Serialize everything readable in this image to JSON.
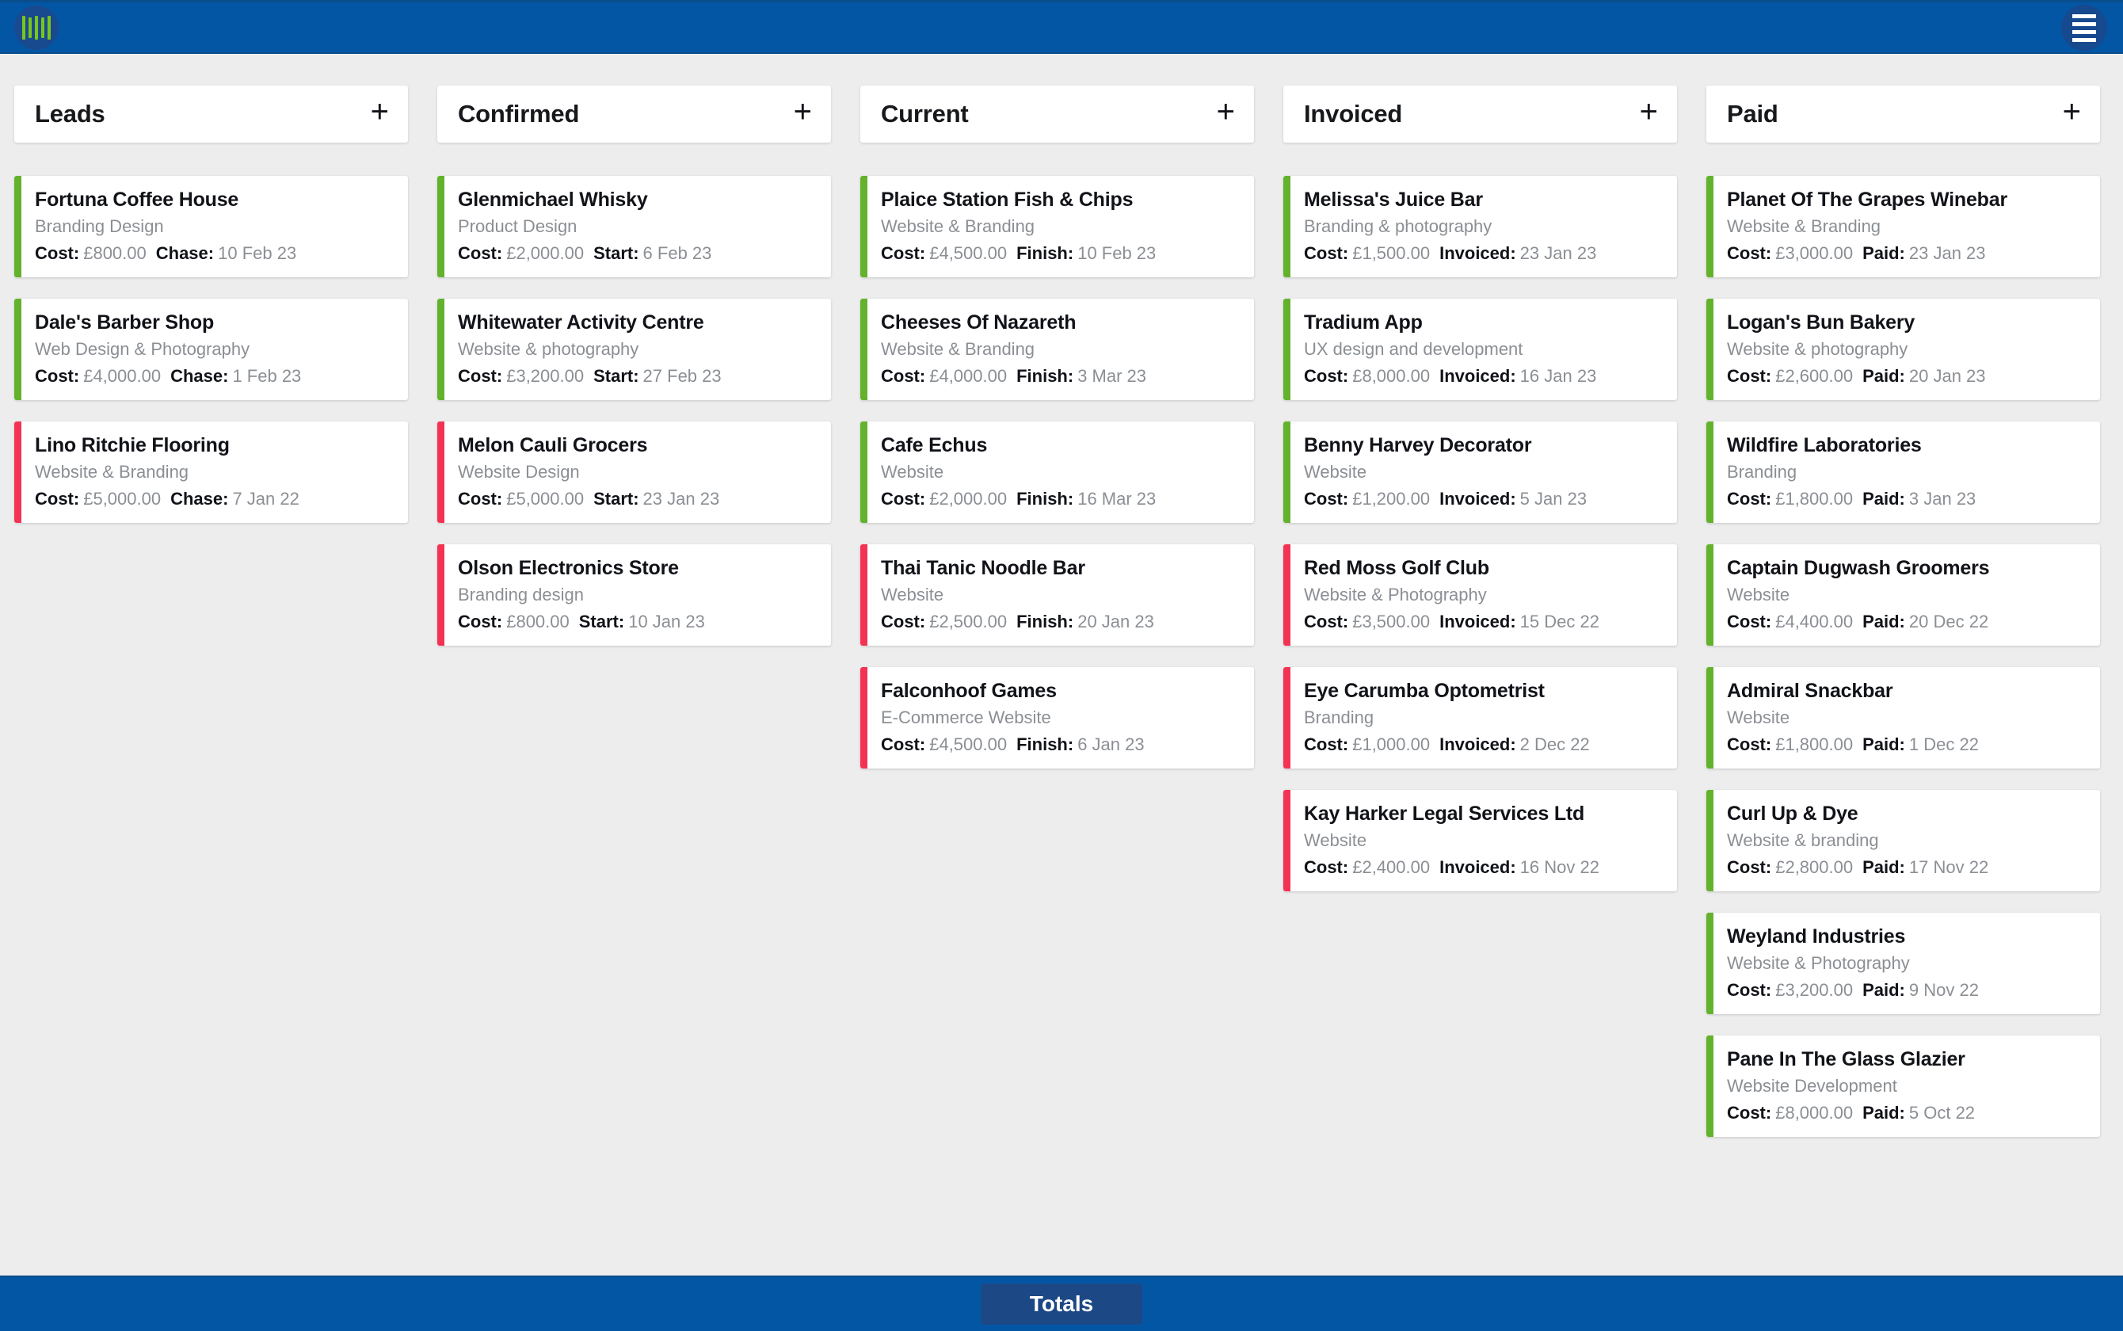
{
  "appbar": {
    "logo_icon": "barcode-logo-icon",
    "menu_icon": "hamburger-menu-icon"
  },
  "colors": {
    "header_blue": "#0356a4",
    "footer_blue": "#0356a4",
    "totals_button": "#1c4886",
    "accent_green": "#63b22d",
    "accent_red": "#f43254",
    "board_background": "#ededed",
    "card_background": "#ffffff"
  },
  "board": {
    "add_label": "+",
    "columns": [
      {
        "title": "Leads",
        "date_label": "Chase:",
        "cost_label": "Cost:",
        "cards": [
          {
            "name": "Fortuna Coffee House",
            "service": "Branding Design",
            "cost": "£800.00",
            "date": "10 Feb 23",
            "accent": "green"
          },
          {
            "name": "Dale's Barber Shop",
            "service": "Web Design & Photography",
            "cost": "£4,000.00",
            "date": "1 Feb 23",
            "accent": "green"
          },
          {
            "name": "Lino Ritchie Flooring",
            "service": "Website & Branding",
            "cost": "£5,000.00",
            "date": "7 Jan 22",
            "accent": "red"
          }
        ]
      },
      {
        "title": "Confirmed",
        "date_label": "Start:",
        "cost_label": "Cost:",
        "cards": [
          {
            "name": "Glenmichael Whisky",
            "service": "Product Design",
            "cost": "£2,000.00",
            "date": "6 Feb 23",
            "accent": "green"
          },
          {
            "name": "Whitewater Activity Centre",
            "service": "Website & photography",
            "cost": "£3,200.00",
            "date": "27 Feb 23",
            "accent": "green"
          },
          {
            "name": "Melon Cauli Grocers",
            "service": "Website Design",
            "cost": "£5,000.00",
            "date": "23 Jan 23",
            "accent": "red"
          },
          {
            "name": "Olson Electronics Store",
            "service": "Branding design",
            "cost": "£800.00",
            "date": "10 Jan 23",
            "accent": "red"
          }
        ]
      },
      {
        "title": "Current",
        "date_label": "Finish:",
        "cost_label": "Cost:",
        "cards": [
          {
            "name": "Plaice Station Fish & Chips",
            "service": "Website & Branding",
            "cost": "£4,500.00",
            "date": "10 Feb 23",
            "accent": "green"
          },
          {
            "name": "Cheeses Of Nazareth",
            "service": "Website & Branding",
            "cost": "£4,000.00",
            "date": "3 Mar 23",
            "accent": "green"
          },
          {
            "name": "Cafe Echus",
            "service": "Website",
            "cost": "£2,000.00",
            "date": "16 Mar 23",
            "accent": "green"
          },
          {
            "name": "Thai Tanic Noodle Bar",
            "service": "Website",
            "cost": "£2,500.00",
            "date": "20 Jan 23",
            "accent": "red"
          },
          {
            "name": "Falconhoof Games",
            "service": "E-Commerce Website",
            "cost": "£4,500.00",
            "date": "6 Jan 23",
            "accent": "red"
          }
        ]
      },
      {
        "title": "Invoiced",
        "date_label": "Invoiced:",
        "cost_label": "Cost:",
        "cards": [
          {
            "name": "Melissa's Juice Bar",
            "service": "Branding & photography",
            "cost": "£1,500.00",
            "date": "23 Jan 23",
            "accent": "green"
          },
          {
            "name": "Tradium App",
            "service": "UX design and development",
            "cost": "£8,000.00",
            "date": "16 Jan 23",
            "accent": "green"
          },
          {
            "name": "Benny Harvey Decorator",
            "service": "Website",
            "cost": "£1,200.00",
            "date": "5 Jan 23",
            "accent": "green"
          },
          {
            "name": "Red Moss Golf Club",
            "service": "Website & Photography",
            "cost": "£3,500.00",
            "date": "15 Dec 22",
            "accent": "red"
          },
          {
            "name": "Eye Carumba Optometrist",
            "service": "Branding",
            "cost": "£1,000.00",
            "date": "2 Dec 22",
            "accent": "red"
          },
          {
            "name": "Kay Harker Legal Services Ltd",
            "service": "Website",
            "cost": "£2,400.00",
            "date": "16 Nov 22",
            "accent": "red"
          }
        ]
      },
      {
        "title": "Paid",
        "date_label": "Paid:",
        "cost_label": "Cost:",
        "cards": [
          {
            "name": "Planet Of The Grapes Winebar",
            "service": "Website & Branding",
            "cost": "£3,000.00",
            "date": "23 Jan 23",
            "accent": "green"
          },
          {
            "name": "Logan's Bun Bakery",
            "service": "Website & photography",
            "cost": "£2,600.00",
            "date": "20 Jan 23",
            "accent": "green"
          },
          {
            "name": "Wildfire Laboratories",
            "service": "Branding",
            "cost": "£1,800.00",
            "date": "3 Jan 23",
            "accent": "green"
          },
          {
            "name": "Captain Dugwash Groomers",
            "service": "Website",
            "cost": "£4,400.00",
            "date": "20 Dec 22",
            "accent": "green"
          },
          {
            "name": "Admiral Snackbar",
            "service": "Website",
            "cost": "£1,800.00",
            "date": "1 Dec 22",
            "accent": "green"
          },
          {
            "name": "Curl Up & Dye",
            "service": "Website & branding",
            "cost": "£2,800.00",
            "date": "17 Nov 22",
            "accent": "green"
          },
          {
            "name": "Weyland Industries",
            "service": "Website & Photography",
            "cost": "£3,200.00",
            "date": "9 Nov 22",
            "accent": "green"
          },
          {
            "name": "Pane In The Glass Glazier",
            "service": "Website Development",
            "cost": "£8,000.00",
            "date": "5 Oct 22",
            "accent": "green"
          }
        ]
      }
    ]
  },
  "footer": {
    "totals_label": "Totals"
  }
}
